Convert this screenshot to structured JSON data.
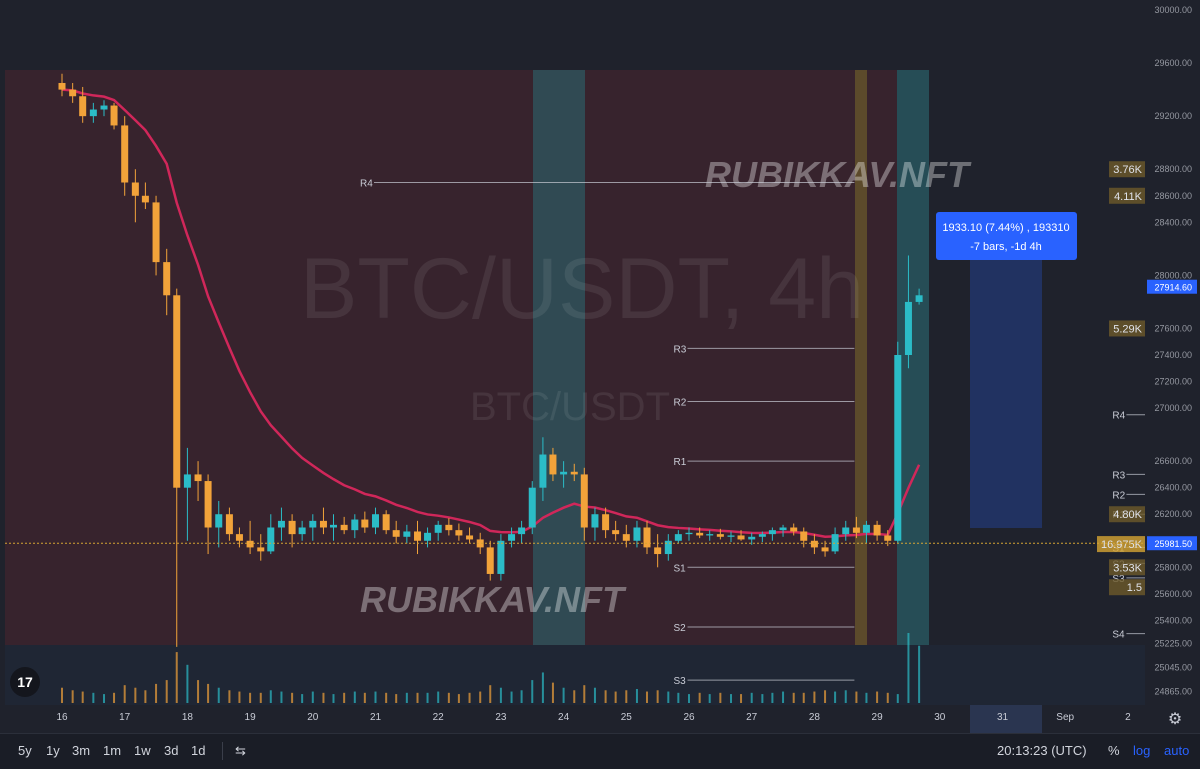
{
  "chart_data": {
    "type": "candlestick",
    "symbol_watermark": "BTC/USDT, 4h",
    "symbol_watermark_small": "BTC/USDT",
    "brand_watermark": "RUBIKKAV.NFT",
    "ylim": [
      24800,
      30000
    ],
    "y_ticks": [
      "30000.00",
      "29600.00",
      "29200.00",
      "28800.00",
      "28600.00",
      "28400.00",
      "28000.00",
      "27600.00",
      "27400.00",
      "27200.00",
      "27000.00",
      "26600.00",
      "26400.00",
      "26200.00",
      "25800.00",
      "25600.00",
      "25400.00",
      "25225.00",
      "25045.00",
      "24865.00"
    ],
    "y_tick_values": [
      30000,
      29600,
      29200,
      28800,
      28600,
      28400,
      28000,
      27600,
      27400,
      27200,
      27000,
      26600,
      26400,
      26200,
      25800,
      25600,
      25400,
      25225,
      25045,
      24865
    ],
    "x_ticks": [
      "16",
      "17",
      "18",
      "19",
      "20",
      "21",
      "22",
      "23",
      "24",
      "25",
      "26",
      "27",
      "28",
      "29",
      "30",
      "31",
      "Sep",
      "2"
    ],
    "x_tick_days": [
      0,
      1,
      2,
      3,
      4,
      5,
      6,
      7,
      8,
      9,
      10,
      11,
      12,
      13,
      14,
      15,
      16,
      17
    ],
    "last_price_label": "27914.60",
    "last_price": 27914.6,
    "current_price_label": "25981.50",
    "current_price": 25981.5,
    "candles": [
      {
        "t": 0.0,
        "o": 29450,
        "h": 29520,
        "l": 29350,
        "c": 29400
      },
      {
        "t": 0.17,
        "o": 29400,
        "h": 29450,
        "l": 29300,
        "c": 29350
      },
      {
        "t": 0.33,
        "o": 29350,
        "h": 29420,
        "l": 29150,
        "c": 29200
      },
      {
        "t": 0.5,
        "o": 29200,
        "h": 29300,
        "l": 29150,
        "c": 29250
      },
      {
        "t": 0.67,
        "o": 29250,
        "h": 29320,
        "l": 29200,
        "c": 29280
      },
      {
        "t": 0.83,
        "o": 29280,
        "h": 29300,
        "l": 29100,
        "c": 29130
      },
      {
        "t": 1.0,
        "o": 29130,
        "h": 29200,
        "l": 28600,
        "c": 28700
      },
      {
        "t": 1.17,
        "o": 28700,
        "h": 28800,
        "l": 28400,
        "c": 28600
      },
      {
        "t": 1.33,
        "o": 28600,
        "h": 28700,
        "l": 28500,
        "c": 28550
      },
      {
        "t": 1.5,
        "o": 28550,
        "h": 28600,
        "l": 28000,
        "c": 28100
      },
      {
        "t": 1.67,
        "o": 28100,
        "h": 28200,
        "l": 27700,
        "c": 27850
      },
      {
        "t": 1.83,
        "o": 27850,
        "h": 27900,
        "l": 25200,
        "c": 26400
      },
      {
        "t": 2.0,
        "o": 26400,
        "h": 26700,
        "l": 26000,
        "c": 26500
      },
      {
        "t": 2.17,
        "o": 26500,
        "h": 26600,
        "l": 26300,
        "c": 26450
      },
      {
        "t": 2.33,
        "o": 26450,
        "h": 26500,
        "l": 25900,
        "c": 26100
      },
      {
        "t": 2.5,
        "o": 26100,
        "h": 26300,
        "l": 25950,
        "c": 26200
      },
      {
        "t": 2.67,
        "o": 26200,
        "h": 26250,
        "l": 26000,
        "c": 26050
      },
      {
        "t": 2.83,
        "o": 26050,
        "h": 26100,
        "l": 25950,
        "c": 26000
      },
      {
        "t": 3.0,
        "o": 26000,
        "h": 26150,
        "l": 25900,
        "c": 25950
      },
      {
        "t": 3.17,
        "o": 25950,
        "h": 26050,
        "l": 25850,
        "c": 25920
      },
      {
        "t": 3.33,
        "o": 25920,
        "h": 26200,
        "l": 25900,
        "c": 26100
      },
      {
        "t": 3.5,
        "o": 26100,
        "h": 26250,
        "l": 26000,
        "c": 26150
      },
      {
        "t": 3.67,
        "o": 26150,
        "h": 26200,
        "l": 25950,
        "c": 26050
      },
      {
        "t": 3.83,
        "o": 26050,
        "h": 26150,
        "l": 26000,
        "c": 26100
      },
      {
        "t": 4.0,
        "o": 26100,
        "h": 26200,
        "l": 26000,
        "c": 26150
      },
      {
        "t": 4.17,
        "o": 26150,
        "h": 26250,
        "l": 26050,
        "c": 26100
      },
      {
        "t": 4.33,
        "o": 26100,
        "h": 26200,
        "l": 26000,
        "c": 26120
      },
      {
        "t": 4.5,
        "o": 26120,
        "h": 26180,
        "l": 26050,
        "c": 26080
      },
      {
        "t": 4.67,
        "o": 26080,
        "h": 26200,
        "l": 26020,
        "c": 26160
      },
      {
        "t": 4.83,
        "o": 26160,
        "h": 26220,
        "l": 26060,
        "c": 26100
      },
      {
        "t": 5.0,
        "o": 26100,
        "h": 26250,
        "l": 26050,
        "c": 26200
      },
      {
        "t": 5.17,
        "o": 26200,
        "h": 26230,
        "l": 26050,
        "c": 26080
      },
      {
        "t": 5.33,
        "o": 26080,
        "h": 26150,
        "l": 25980,
        "c": 26030
      },
      {
        "t": 5.5,
        "o": 26030,
        "h": 26120,
        "l": 25980,
        "c": 26070
      },
      {
        "t": 5.67,
        "o": 26070,
        "h": 26150,
        "l": 25900,
        "c": 26000
      },
      {
        "t": 5.83,
        "o": 26000,
        "h": 26100,
        "l": 25950,
        "c": 26060
      },
      {
        "t": 6.0,
        "o": 26060,
        "h": 26150,
        "l": 26000,
        "c": 26120
      },
      {
        "t": 6.17,
        "o": 26120,
        "h": 26170,
        "l": 26040,
        "c": 26080
      },
      {
        "t": 6.33,
        "o": 26080,
        "h": 26130,
        "l": 26000,
        "c": 26040
      },
      {
        "t": 6.5,
        "o": 26040,
        "h": 26100,
        "l": 25980,
        "c": 26010
      },
      {
        "t": 6.67,
        "o": 26010,
        "h": 26060,
        "l": 25900,
        "c": 25950
      },
      {
        "t": 6.83,
        "o": 25950,
        "h": 26000,
        "l": 25700,
        "c": 25750
      },
      {
        "t": 7.0,
        "o": 25750,
        "h": 26050,
        "l": 25700,
        "c": 26000
      },
      {
        "t": 7.17,
        "o": 26000,
        "h": 26100,
        "l": 25950,
        "c": 26050
      },
      {
        "t": 7.33,
        "o": 26050,
        "h": 26150,
        "l": 25980,
        "c": 26100
      },
      {
        "t": 7.5,
        "o": 26100,
        "h": 26450,
        "l": 26050,
        "c": 26400
      },
      {
        "t": 7.67,
        "o": 26400,
        "h": 26780,
        "l": 26300,
        "c": 26650
      },
      {
        "t": 7.83,
        "o": 26650,
        "h": 26700,
        "l": 26450,
        "c": 26500
      },
      {
        "t": 8.0,
        "o": 26500,
        "h": 26600,
        "l": 26400,
        "c": 26520
      },
      {
        "t": 8.17,
        "o": 26520,
        "h": 26580,
        "l": 26450,
        "c": 26500
      },
      {
        "t": 8.33,
        "o": 26500,
        "h": 26550,
        "l": 26000,
        "c": 26100
      },
      {
        "t": 8.5,
        "o": 26100,
        "h": 26250,
        "l": 26000,
        "c": 26200
      },
      {
        "t": 8.67,
        "o": 26200,
        "h": 26250,
        "l": 26020,
        "c": 26080
      },
      {
        "t": 8.83,
        "o": 26080,
        "h": 26150,
        "l": 26000,
        "c": 26050
      },
      {
        "t": 9.0,
        "o": 26050,
        "h": 26120,
        "l": 25950,
        "c": 26000
      },
      {
        "t": 9.17,
        "o": 26000,
        "h": 26150,
        "l": 25950,
        "c": 26100
      },
      {
        "t": 9.33,
        "o": 26100,
        "h": 26150,
        "l": 25900,
        "c": 25950
      },
      {
        "t": 9.5,
        "o": 25950,
        "h": 26050,
        "l": 25800,
        "c": 25900
      },
      {
        "t": 9.67,
        "o": 25900,
        "h": 26050,
        "l": 25850,
        "c": 26000
      },
      {
        "t": 9.83,
        "o": 26000,
        "h": 26080,
        "l": 25980,
        "c": 26050
      },
      {
        "t": 10.0,
        "o": 26050,
        "h": 26100,
        "l": 26000,
        "c": 26060
      },
      {
        "t": 10.17,
        "o": 26060,
        "h": 26100,
        "l": 26020,
        "c": 26040
      },
      {
        "t": 10.33,
        "o": 26040,
        "h": 26080,
        "l": 26000,
        "c": 26050
      },
      {
        "t": 10.5,
        "o": 26050,
        "h": 26090,
        "l": 26010,
        "c": 26030
      },
      {
        "t": 10.67,
        "o": 26030,
        "h": 26070,
        "l": 25990,
        "c": 26040
      },
      {
        "t": 10.83,
        "o": 26040,
        "h": 26080,
        "l": 26000,
        "c": 26010
      },
      {
        "t": 11.0,
        "o": 26010,
        "h": 26060,
        "l": 25970,
        "c": 26030
      },
      {
        "t": 11.17,
        "o": 26030,
        "h": 26070,
        "l": 25990,
        "c": 26050
      },
      {
        "t": 11.33,
        "o": 26050,
        "h": 26100,
        "l": 26000,
        "c": 26080
      },
      {
        "t": 11.5,
        "o": 26080,
        "h": 26120,
        "l": 26030,
        "c": 26100
      },
      {
        "t": 11.67,
        "o": 26100,
        "h": 26130,
        "l": 26040,
        "c": 26070
      },
      {
        "t": 11.83,
        "o": 26070,
        "h": 26100,
        "l": 25950,
        "c": 26000
      },
      {
        "t": 12.0,
        "o": 26000,
        "h": 26050,
        "l": 25900,
        "c": 25950
      },
      {
        "t": 12.17,
        "o": 25950,
        "h": 26000,
        "l": 25880,
        "c": 25920
      },
      {
        "t": 12.33,
        "o": 25920,
        "h": 26100,
        "l": 25900,
        "c": 26050
      },
      {
        "t": 12.5,
        "o": 26050,
        "h": 26150,
        "l": 26000,
        "c": 26100
      },
      {
        "t": 12.67,
        "o": 26100,
        "h": 26180,
        "l": 26020,
        "c": 26060
      },
      {
        "t": 12.83,
        "o": 26060,
        "h": 26150,
        "l": 25980,
        "c": 26120
      },
      {
        "t": 13.0,
        "o": 26120,
        "h": 26150,
        "l": 26000,
        "c": 26040
      },
      {
        "t": 13.17,
        "o": 26040,
        "h": 26080,
        "l": 25960,
        "c": 26000
      },
      {
        "t": 13.33,
        "o": 26000,
        "h": 27500,
        "l": 25980,
        "c": 27400
      },
      {
        "t": 13.5,
        "o": 27400,
        "h": 28150,
        "l": 27300,
        "c": 27800
      },
      {
        "t": 13.67,
        "o": 27800,
        "h": 27900,
        "l": 27780,
        "c": 27850
      }
    ],
    "volumes": [
      12,
      10,
      9,
      8,
      7,
      8,
      14,
      12,
      10,
      15,
      18,
      40,
      30,
      18,
      15,
      12,
      10,
      9,
      8,
      8,
      10,
      9,
      8,
      7,
      9,
      8,
      7,
      8,
      9,
      8,
      9,
      8,
      7,
      8,
      8,
      8,
      9,
      8,
      7,
      8,
      9,
      14,
      12,
      9,
      10,
      18,
      24,
      16,
      12,
      10,
      14,
      12,
      10,
      9,
      10,
      11,
      9,
      10,
      9,
      8,
      7,
      8,
      7,
      8,
      7,
      7,
      8,
      7,
      8,
      9,
      8,
      8,
      9,
      10,
      9,
      10,
      9,
      8,
      9,
      8,
      7,
      55,
      45,
      18
    ],
    "levels": [
      {
        "label": "R4",
        "price": 28700,
        "t0": 0,
        "t1": 12
      },
      {
        "label": "R3",
        "price": 27450,
        "t0": 5,
        "t1": 12
      },
      {
        "label": "R2",
        "price": 27050,
        "t0": 5,
        "t1": 12
      },
      {
        "label": "R1",
        "price": 26600,
        "t0": 5,
        "t1": 12
      },
      {
        "label": "S1",
        "price": 25800,
        "t0": 5,
        "t1": 12
      },
      {
        "label": "S2",
        "price": 25350,
        "t0": 5,
        "t1": 12
      },
      {
        "label": "S3",
        "price": 24950,
        "t0": 5,
        "t1": 12
      },
      {
        "label": "R4",
        "price": 26950,
        "t0": 12,
        "t1": 18
      },
      {
        "label": "R3",
        "price": 26500,
        "t0": 12,
        "t1": 18
      },
      {
        "label": "R2",
        "price": 26350,
        "t0": 12,
        "t1": 18
      },
      {
        "label": "R1",
        "price": 26200,
        "t0": 12,
        "t1": 18
      },
      {
        "label": "S1",
        "price": 25950,
        "t0": 12,
        "t1": 18
      },
      {
        "label": "S2",
        "price": 25830,
        "t0": 12,
        "t1": 18
      },
      {
        "label": "S3",
        "price": 25720,
        "t0": 12,
        "t1": 18
      },
      {
        "label": "S4",
        "price": 25300,
        "t0": 12,
        "t1": 18
      }
    ],
    "volume_profile_labels": [
      "3.76K",
      "4.11K",
      "5.29K",
      "4.80K",
      "16.975K",
      "3.53K",
      "1.5"
    ],
    "volume_profile_prices": [
      28800,
      28600,
      27600,
      26200,
      25975,
      25800,
      25650
    ],
    "measure_box": {
      "line1": "1933.10 (7.44%) , 193310",
      "line2": "-7 bars, -1d 4h"
    }
  },
  "toolbar": {
    "timeframes": [
      "5y",
      "1y",
      "3m",
      "1m",
      "1w",
      "3d",
      "1d"
    ],
    "clock": "20:13:23 (UTC)",
    "percent": "%",
    "log": "log",
    "auto": "auto"
  },
  "colors": {
    "bg": "#1f222c",
    "up": "#2bbcc7",
    "down": "#f2a33a",
    "ema": "#d0275a",
    "accent": "#2962ff"
  }
}
